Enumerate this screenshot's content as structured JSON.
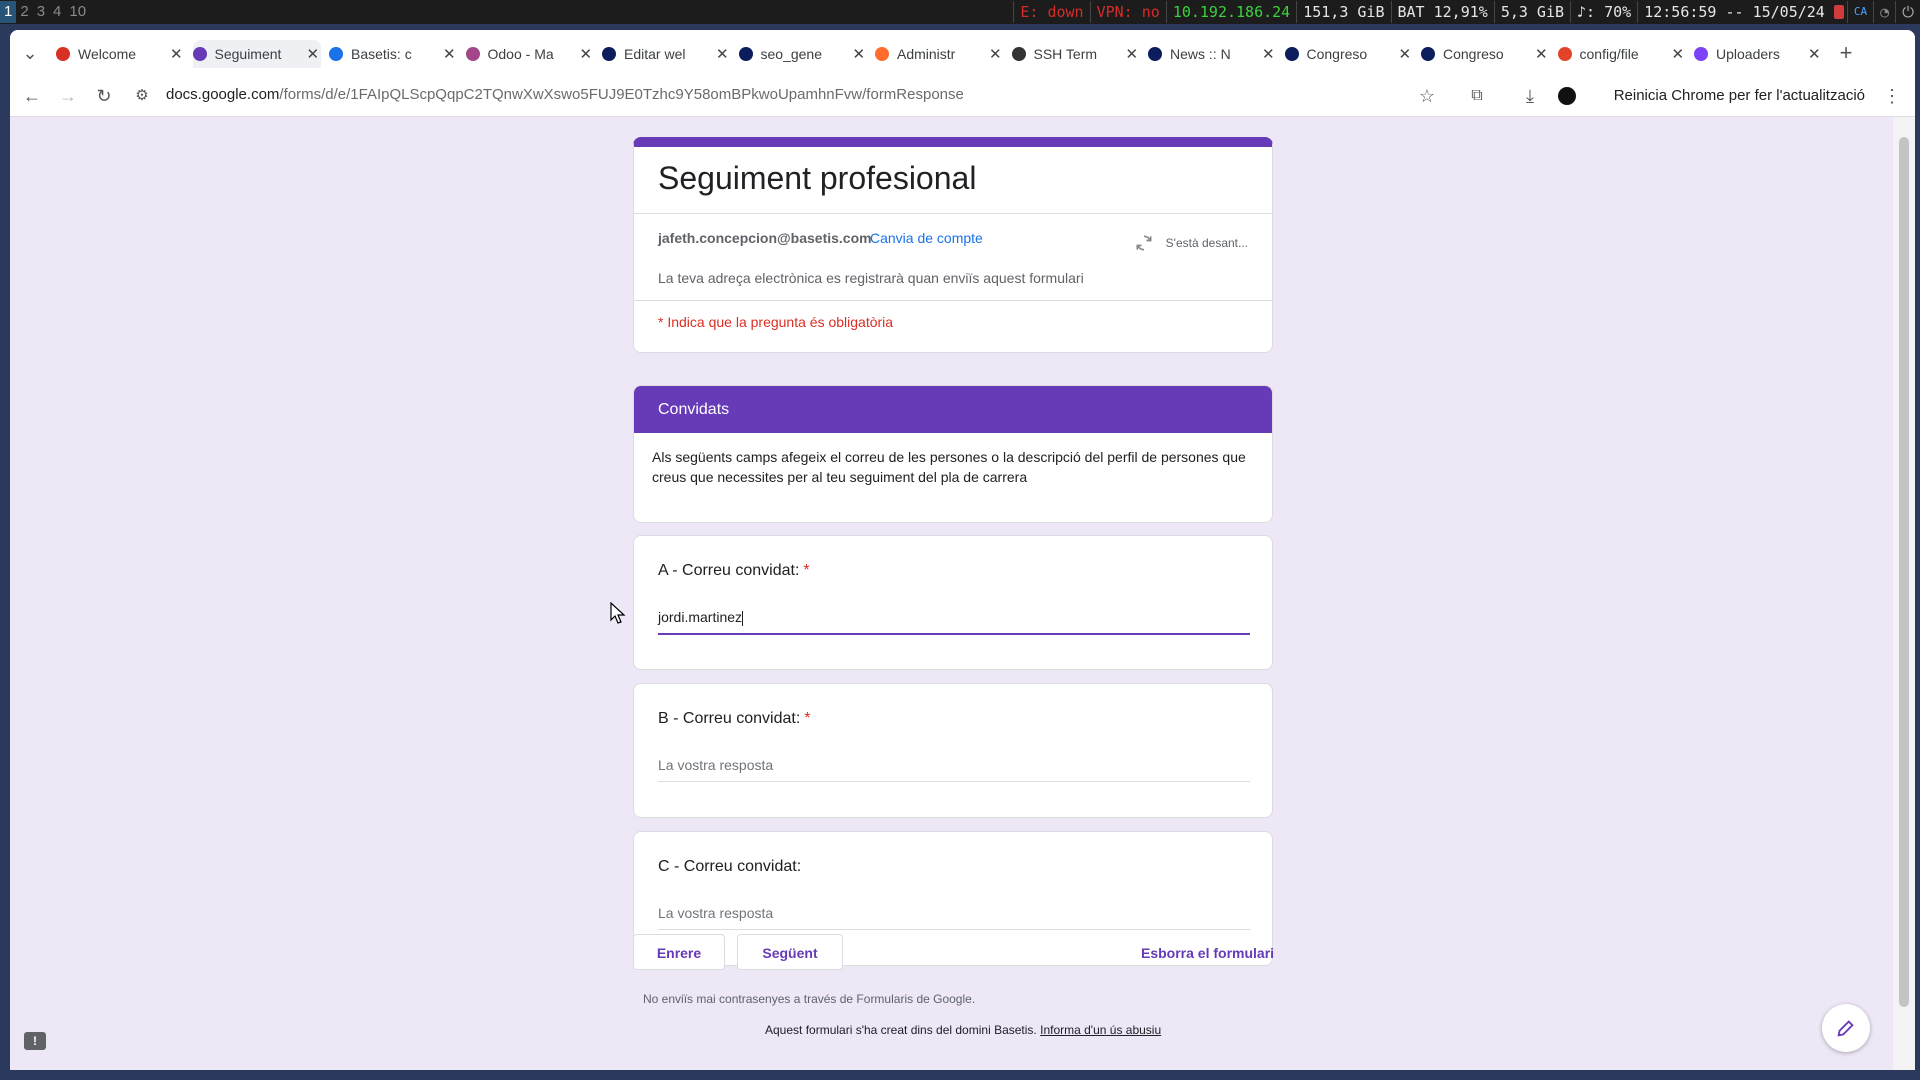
{
  "system_bar": {
    "workspaces": [
      "1",
      "2",
      "3",
      "4",
      "10"
    ],
    "active_workspace": "1",
    "eth": "E: down",
    "vpn": "VPN: no",
    "ip": "10.192.186.24",
    "disk": "151,3 GiB",
    "battery": "BAT 12,91%",
    "memory": "5,3 GiB",
    "volume": "♪: 70%",
    "clock": "12:56:59 -- 15/05/24",
    "lang": "CA"
  },
  "tabs": [
    {
      "title": "Welcome",
      "icon": "gmail-icon",
      "color": "#d93025"
    },
    {
      "title": "Seguiment",
      "icon": "forms-icon",
      "color": "#673ab7"
    },
    {
      "title": "Basetis: c",
      "icon": "calendar-icon",
      "color": "#1a73e8"
    },
    {
      "title": "Odoo - Ma",
      "icon": "odoo-icon",
      "color": "#a24689"
    },
    {
      "title": "Editar wel",
      "icon": "site-icon",
      "color": "#0b1d5c"
    },
    {
      "title": "seo_gene",
      "icon": "site-icon",
      "color": "#0b1d5c"
    },
    {
      "title": "Administr",
      "icon": "cpanel-icon",
      "color": "#ff6c2c"
    },
    {
      "title": "SSH Term",
      "icon": "ssh-icon",
      "color": "#333333"
    },
    {
      "title": "News :: N",
      "icon": "site-icon",
      "color": "#0b1d5c"
    },
    {
      "title": "Congreso",
      "icon": "site-icon",
      "color": "#0b1d5c"
    },
    {
      "title": "Congreso",
      "icon": "site-icon",
      "color": "#0b1d5c"
    },
    {
      "title": "config/file",
      "icon": "gitlab-icon",
      "color": "#e24329"
    },
    {
      "title": "Uploaders",
      "icon": "app-icon",
      "color": "#7b42f6"
    }
  ],
  "browser": {
    "url_domain": "docs.google.com",
    "url_path": "/forms/d/e/1FAIpQLScpQqpC2TQnwXwXswo5FUJ9E0Tzhc9Y58omBPkwoUpamhnFvw/formResponse",
    "restart_label": "Reinicia Chrome per fer l'actualització"
  },
  "form": {
    "title": "Seguiment profesional",
    "email": "jafeth.concepcion@basetis.com",
    "switch_account": "Canvia de compte",
    "saving": "S'està desant...",
    "email_note": "La teva adreça electrònica es registrarà quan enviïs aquest formulari",
    "required_note": "* Indica que la pregunta és obligatòria",
    "section_title": "Convidats",
    "section_desc": "Als següents camps afegeix el correu de les persones o la descripció del perfil de persones que creus que necessites per al teu seguiment del pla de carrera",
    "questions": [
      {
        "label": "A - Correu convidat:",
        "required": "*",
        "value": "jordi.martinez",
        "placeholder": ""
      },
      {
        "label": "B - Correu convidat:",
        "required": "*",
        "value": "",
        "placeholder": "La vostra resposta"
      },
      {
        "label": "C - Correu convidat:",
        "required": "",
        "value": "",
        "placeholder": "La vostra resposta"
      }
    ],
    "back_button": "Enrere",
    "next_button": "Següent",
    "clear_form": "Esborra el formulari",
    "password_note": "No enviïs mai contrasenyes a través de Formularis de Google.",
    "domain_note": "Aquest formulari s'ha creat dins del domini Basetis.",
    "report_abuse": "Informa d'un ús abusiu"
  },
  "colors": {
    "accent": "#673ab7",
    "page_bg": "#ede7f6",
    "required": "#d93025",
    "link": "#1a73e8"
  }
}
